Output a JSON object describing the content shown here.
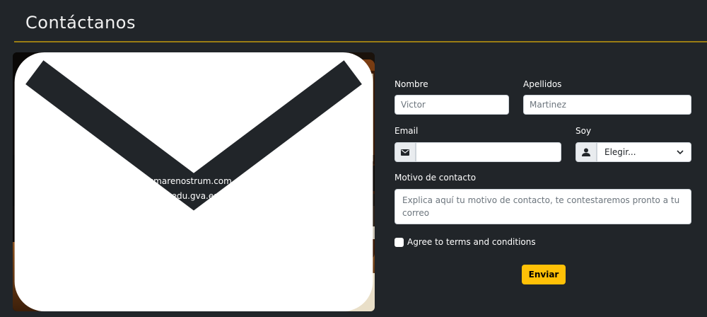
{
  "header": {
    "title": "Contáctanos"
  },
  "photo": {
    "email": "correo@iesmarenostrum.com",
    "secondary": "03012736@edu.gva.es"
  },
  "form": {
    "nombre_label": "Nombre",
    "nombre_value": "Victor",
    "apellidos_label": "Apellidos",
    "apellidos_value": "Martinez",
    "email_label": "Email",
    "email_value": "",
    "soy_label": "Soy",
    "soy_selected": "Elegir...",
    "motivo_label": "Motivo de contacto",
    "motivo_placeholder": "Explica aquí tu motivo de contacto, te contestaremos pronto a tu correo",
    "terms_label": "Agree to terms and conditions",
    "submit_label": "Enviar"
  },
  "colors": {
    "background": "#212529",
    "accent_rule": "#9b7d14",
    "button": "#ffc107"
  }
}
